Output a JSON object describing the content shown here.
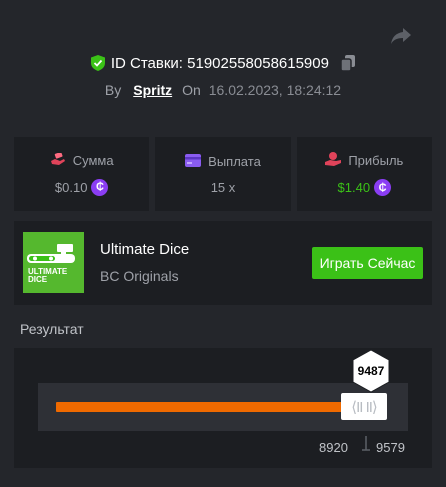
{
  "bet": {
    "id_label": "ID Ставки:",
    "id_value": "51902558058615909",
    "by_label": "By",
    "user": "Spritz",
    "on_label": "On",
    "date": "16.02.2023, 18:24:12"
  },
  "stats": {
    "amount": {
      "label": "Сумма",
      "value": "$0.10",
      "coin": "₵"
    },
    "payout": {
      "label": "Выплата",
      "value": "15 x"
    },
    "profit": {
      "label": "Прибыль",
      "value": "$1.40",
      "coin": "₵"
    }
  },
  "game": {
    "title": "Ultimate Dice",
    "provider": "BC Originals",
    "play_label": "Играть Сейчас",
    "thumb_line1": "ULTIMATE",
    "thumb_line2": "DICE"
  },
  "result": {
    "title": "Результат",
    "roll": "9487",
    "range_low": "8920",
    "range_high": "9579",
    "fill_fraction": 0.855,
    "handle_text": "⟨II II⟩"
  },
  "colors": {
    "background": "#24262b",
    "panel": "#1c1e22",
    "accent_green": "#3bc117",
    "profit_green": "#3bc117",
    "bar_orange": "#f06a00",
    "coin_purple": "#8a3df3"
  },
  "icons": {
    "share": "share-arrow-icon",
    "shield": "shield-check-icon",
    "copy": "copy-icon",
    "amount": "coins-hand-icon",
    "payout": "card-icon",
    "profit": "profit-icon"
  }
}
